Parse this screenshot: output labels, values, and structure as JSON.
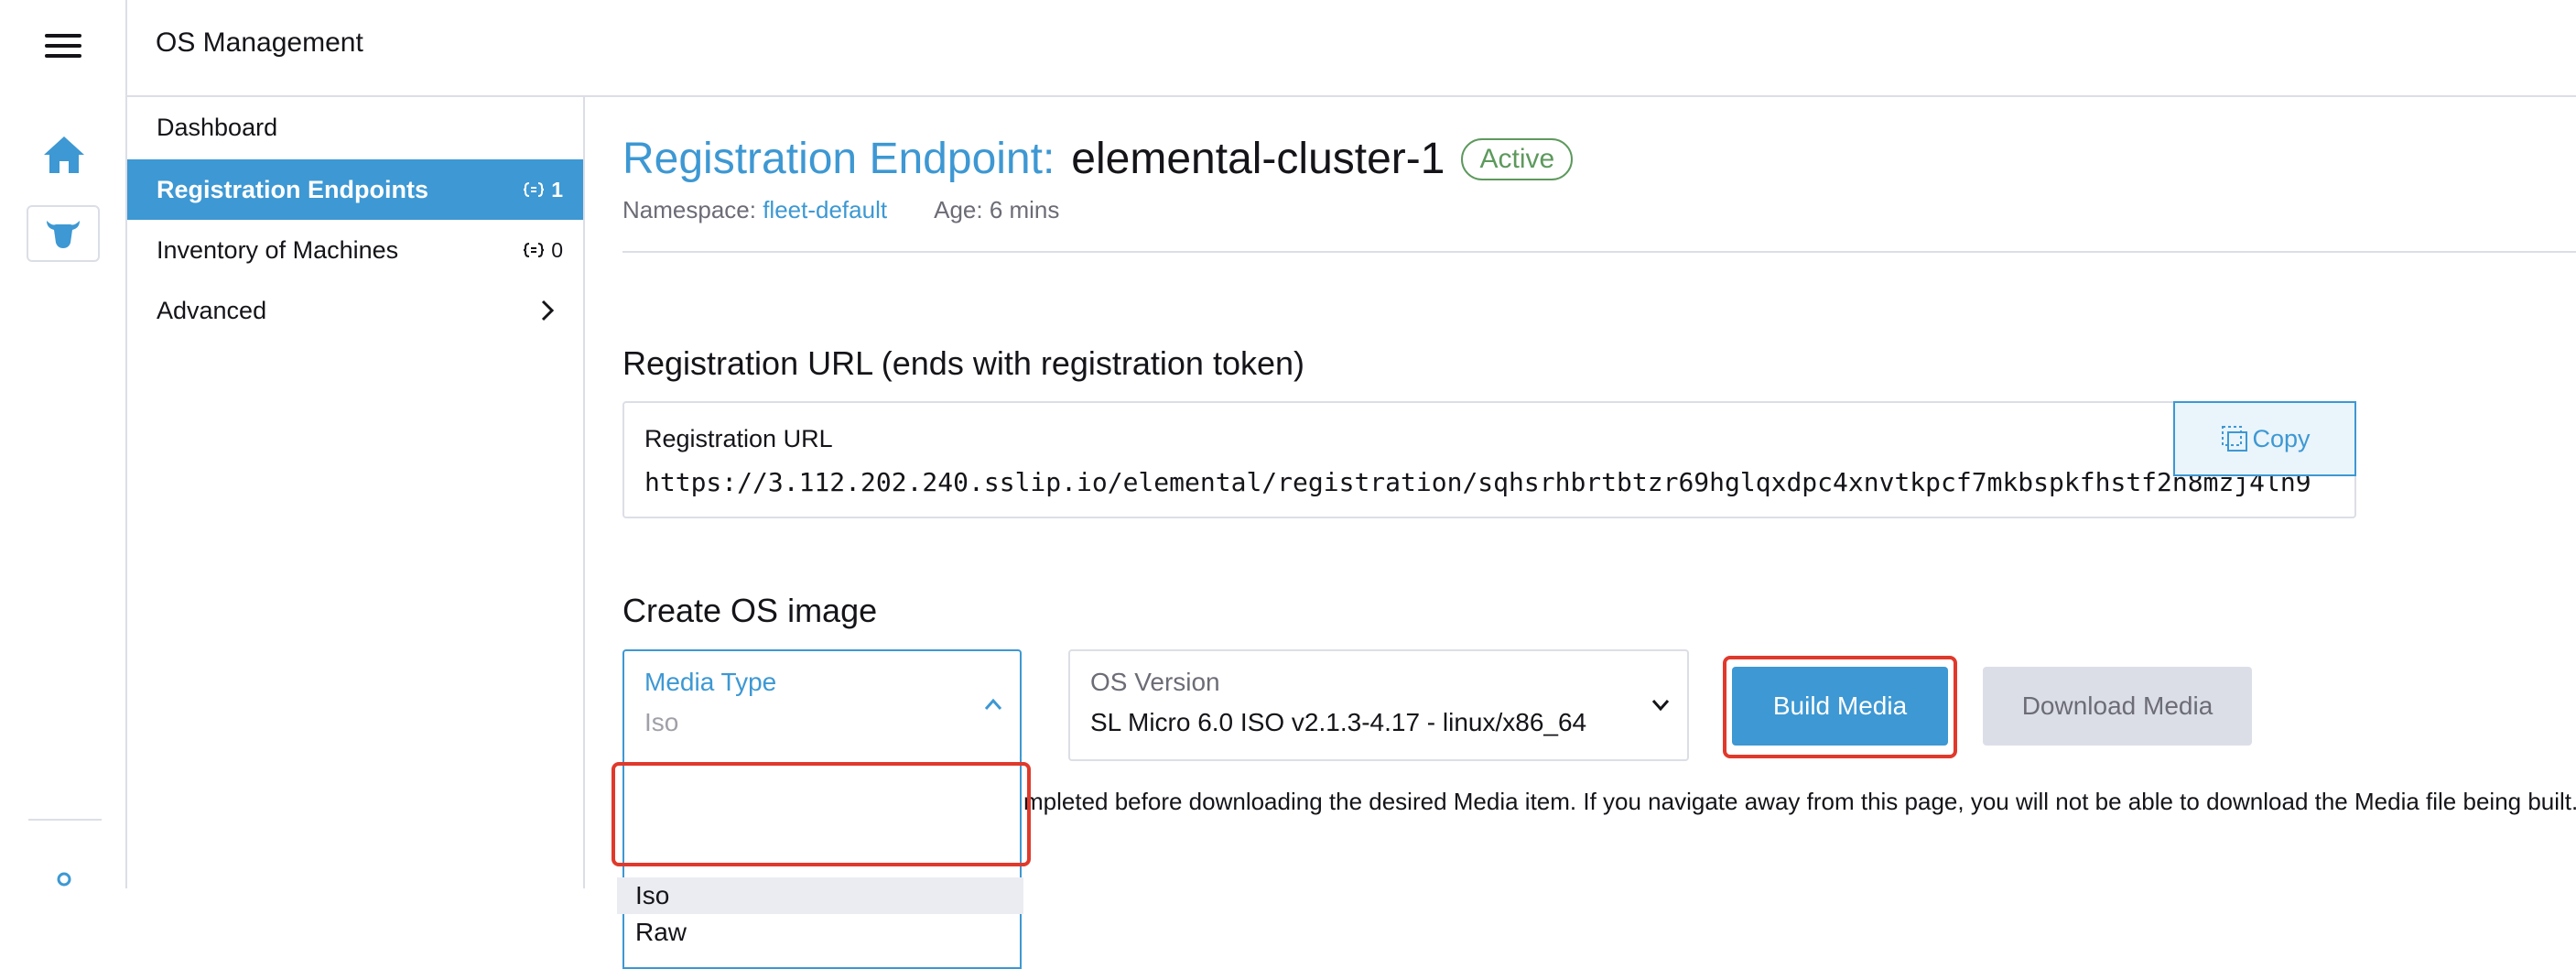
{
  "header": {
    "title": "OS Management"
  },
  "rail": {
    "menu_icon": "hamburger-menu-icon",
    "home_icon": "home-icon",
    "app_icon": "elemental-cow-icon"
  },
  "sidenav": {
    "items": [
      {
        "label": "Dashboard"
      },
      {
        "label": "Registration Endpoints",
        "count": "1",
        "active": true
      },
      {
        "label": "Inventory of Machines",
        "count": "0"
      },
      {
        "label": "Advanced"
      }
    ]
  },
  "page": {
    "kind": "Registration Endpoint:",
    "name": "elemental-cluster-1",
    "status": "Active",
    "namespace_label": "Namespace:",
    "namespace_value": "fleet-default",
    "age": "Age: 6 mins"
  },
  "registration": {
    "section_title": "Registration URL (ends with registration token)",
    "field_label": "Registration URL",
    "url": "https://3.112.202.240.sslip.io/elemental/registration/sqhsrhbrtbtzr69hglqxdpc4xnvtkpcf7mkbspkfhstf2n8mzj4ln9",
    "copy_label": "Copy"
  },
  "os_image": {
    "section_title": "Create OS image",
    "media_type": {
      "label": "Media Type",
      "value": "Iso",
      "options": [
        "Iso",
        "Raw"
      ]
    },
    "os_version": {
      "label": "OS Version",
      "value": "SL Micro 6.0 ISO v2.1.3-4.17 - linux/x86_64"
    },
    "build_label": "Build Media",
    "download_label": "Download Media",
    "notice": "mpleted before downloading the desired Media item. If you navigate away from this page, you will not be able to download the Media file being built."
  },
  "colors": {
    "accent": "#3d98d3",
    "active_badge": "#5d995d",
    "highlight": "#e0392b",
    "disabled_bg": "#dcdee7"
  }
}
